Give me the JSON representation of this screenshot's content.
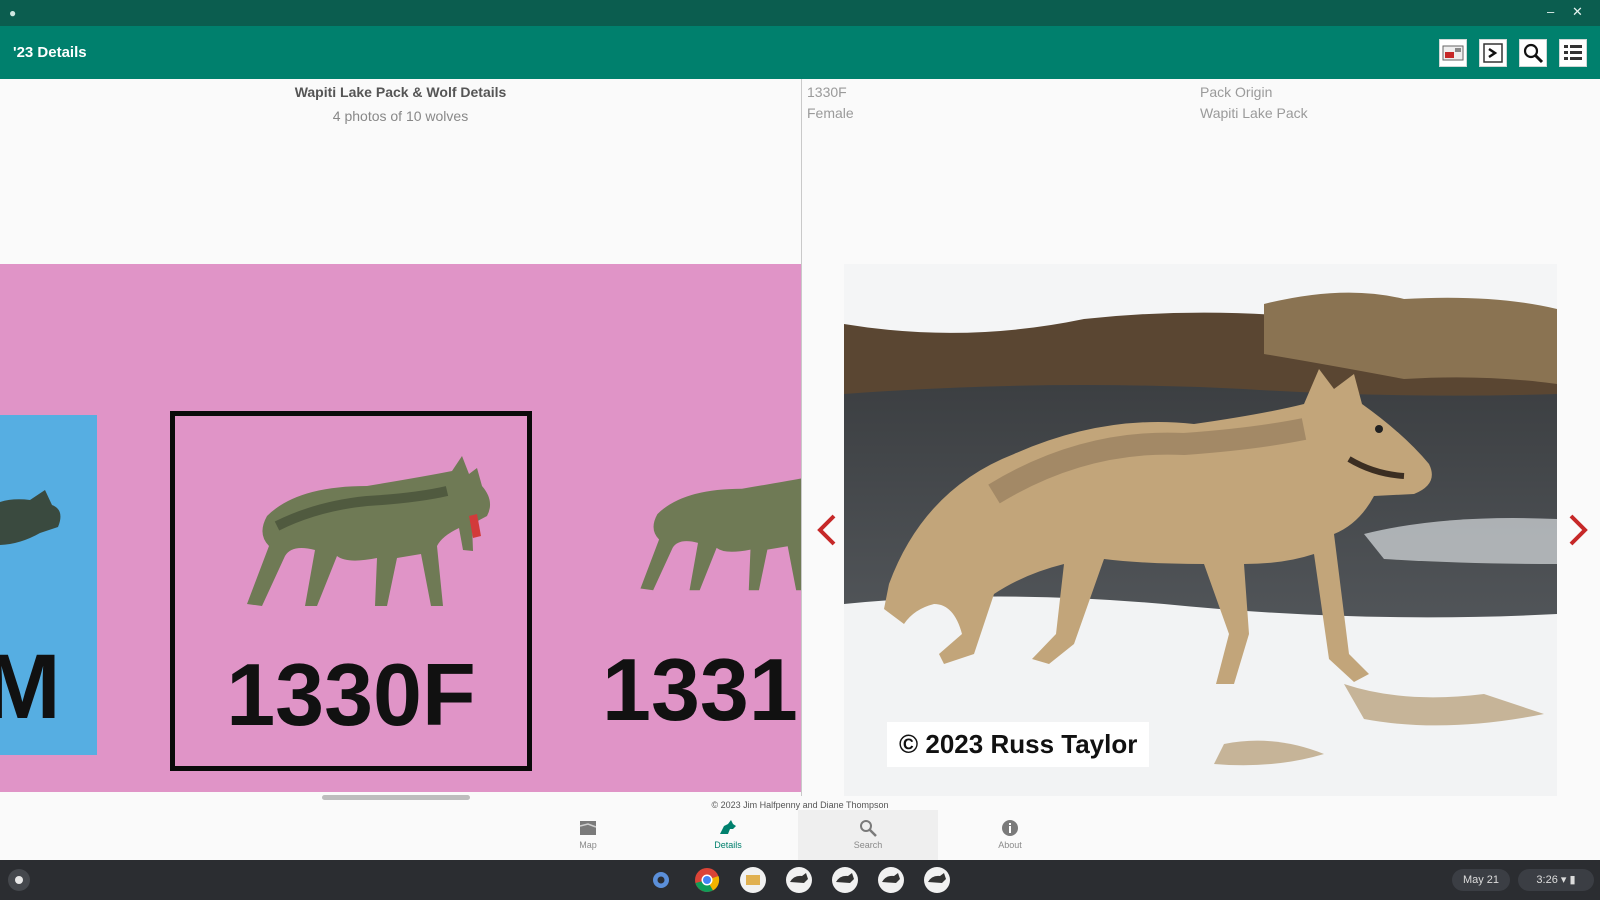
{
  "app": {
    "title": "'23 Details",
    "toolbar_icons": [
      "gallery-icon",
      "export-icon",
      "search-zoom-icon",
      "list-icon"
    ]
  },
  "left_panel": {
    "title": "Wapiti Lake Pack & Wolf Details",
    "subtitle": "4 photos of 10 wolves",
    "cards": [
      {
        "label": "M",
        "background": "#56aee2",
        "selected": false
      },
      {
        "label": "1330F",
        "background": "#e094c7",
        "selected": true
      },
      {
        "label": "1331",
        "background": "#e094c7",
        "selected": false
      }
    ]
  },
  "right_panel": {
    "wolf_id": "1330F",
    "sex": "Female",
    "origin_label": "Pack Origin",
    "origin_value": "Wapiti Lake Pack",
    "photo_credit": "© 2023 Russ Taylor",
    "prev_icon": "chevron-left-icon",
    "next_icon": "chevron-right-icon"
  },
  "footer": {
    "copyright": "© 2023 Jim Halfpenny and Diane Thompson"
  },
  "bottom_nav": [
    {
      "label": "Map",
      "icon": "map-icon",
      "active": false
    },
    {
      "label": "Details",
      "icon": "wolf-icon",
      "active": true
    },
    {
      "label": "Search",
      "icon": "search-icon",
      "active": false
    },
    {
      "label": "About",
      "icon": "info-icon",
      "active": false
    }
  ],
  "shelf": {
    "date": "May 21",
    "time": "3:26"
  },
  "colors": {
    "primary": "#00806d",
    "title_strip": "#0b5d4f",
    "card_pink": "#e094c7",
    "card_blue": "#56aee2",
    "arrow_red": "#c62828"
  }
}
